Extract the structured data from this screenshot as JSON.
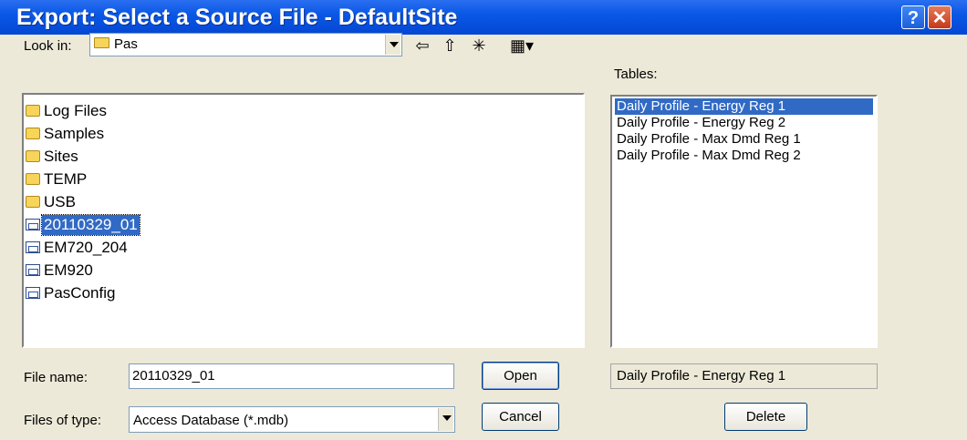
{
  "window": {
    "title": "Export: Select a Source File - DefaultSite",
    "help_glyph": "?",
    "close_glyph": "✕"
  },
  "lookin": {
    "label": "Look in:",
    "value": "Pas"
  },
  "toolbar": {
    "back_glyph": "⇦",
    "up_glyph": "⇧",
    "newfolder_glyph": "✳",
    "view_glyph": "▦▾"
  },
  "files": [
    {
      "name": "Log Files",
      "kind": "folder"
    },
    {
      "name": "Samples",
      "kind": "folder"
    },
    {
      "name": "Sites",
      "kind": "folder"
    },
    {
      "name": "TEMP",
      "kind": "folder"
    },
    {
      "name": "USB",
      "kind": "folder"
    },
    {
      "name": "20110329_01",
      "kind": "database",
      "selected": true
    },
    {
      "name": "EM720_204",
      "kind": "database"
    },
    {
      "name": "EM920",
      "kind": "database"
    },
    {
      "name": "PasConfig",
      "kind": "database"
    }
  ],
  "tables": {
    "label": "Tables:",
    "items": [
      {
        "name": "Daily Profile - Energy Reg 1",
        "selected": true
      },
      {
        "name": "Daily Profile - Energy Reg 2"
      },
      {
        "name": "Daily Profile - Max Dmd Reg 1"
      },
      {
        "name": "Daily Profile - Max Dmd Reg 2"
      }
    ],
    "current": "Daily Profile - Energy Reg 1"
  },
  "filename": {
    "label": "File name:",
    "value": "20110329_01"
  },
  "filetype": {
    "label": "Files of type:",
    "value": "Access Database (*.mdb)"
  },
  "buttons": {
    "open": "Open",
    "cancel": "Cancel",
    "delete": "Delete"
  },
  "colors": {
    "title_bar": "#0a58e6",
    "selection": "#316ac5",
    "face": "#ece9d8"
  }
}
